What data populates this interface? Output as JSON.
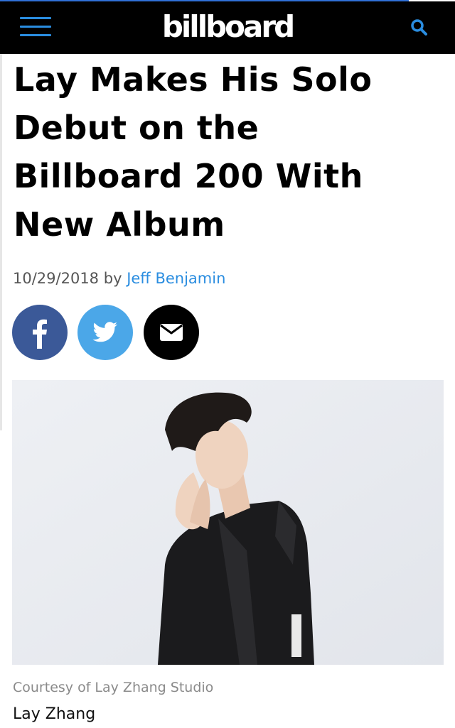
{
  "header": {
    "logo_text": "billboard",
    "menu_icon": "hamburger-menu-icon",
    "search_icon": "search-icon",
    "accent_color": "#2a8de0",
    "background_color": "#000000"
  },
  "article": {
    "headline_lines": [
      "Lay Makes His Solo",
      "Debut on the",
      "Billboard 200 With",
      "New Album"
    ],
    "date": "10/29/2018",
    "by": "by",
    "author": "Jeff Benjamin"
  },
  "share": [
    {
      "network": "facebook",
      "icon": "facebook-icon",
      "color": "#3b5998"
    },
    {
      "network": "twitter",
      "icon": "twitter-icon",
      "color": "#4ba7e8"
    },
    {
      "network": "email",
      "icon": "envelope-icon",
      "color": "#000000"
    }
  ],
  "image": {
    "credit": "Courtesy of Lay Zhang Studio",
    "caption": "Lay Zhang"
  }
}
